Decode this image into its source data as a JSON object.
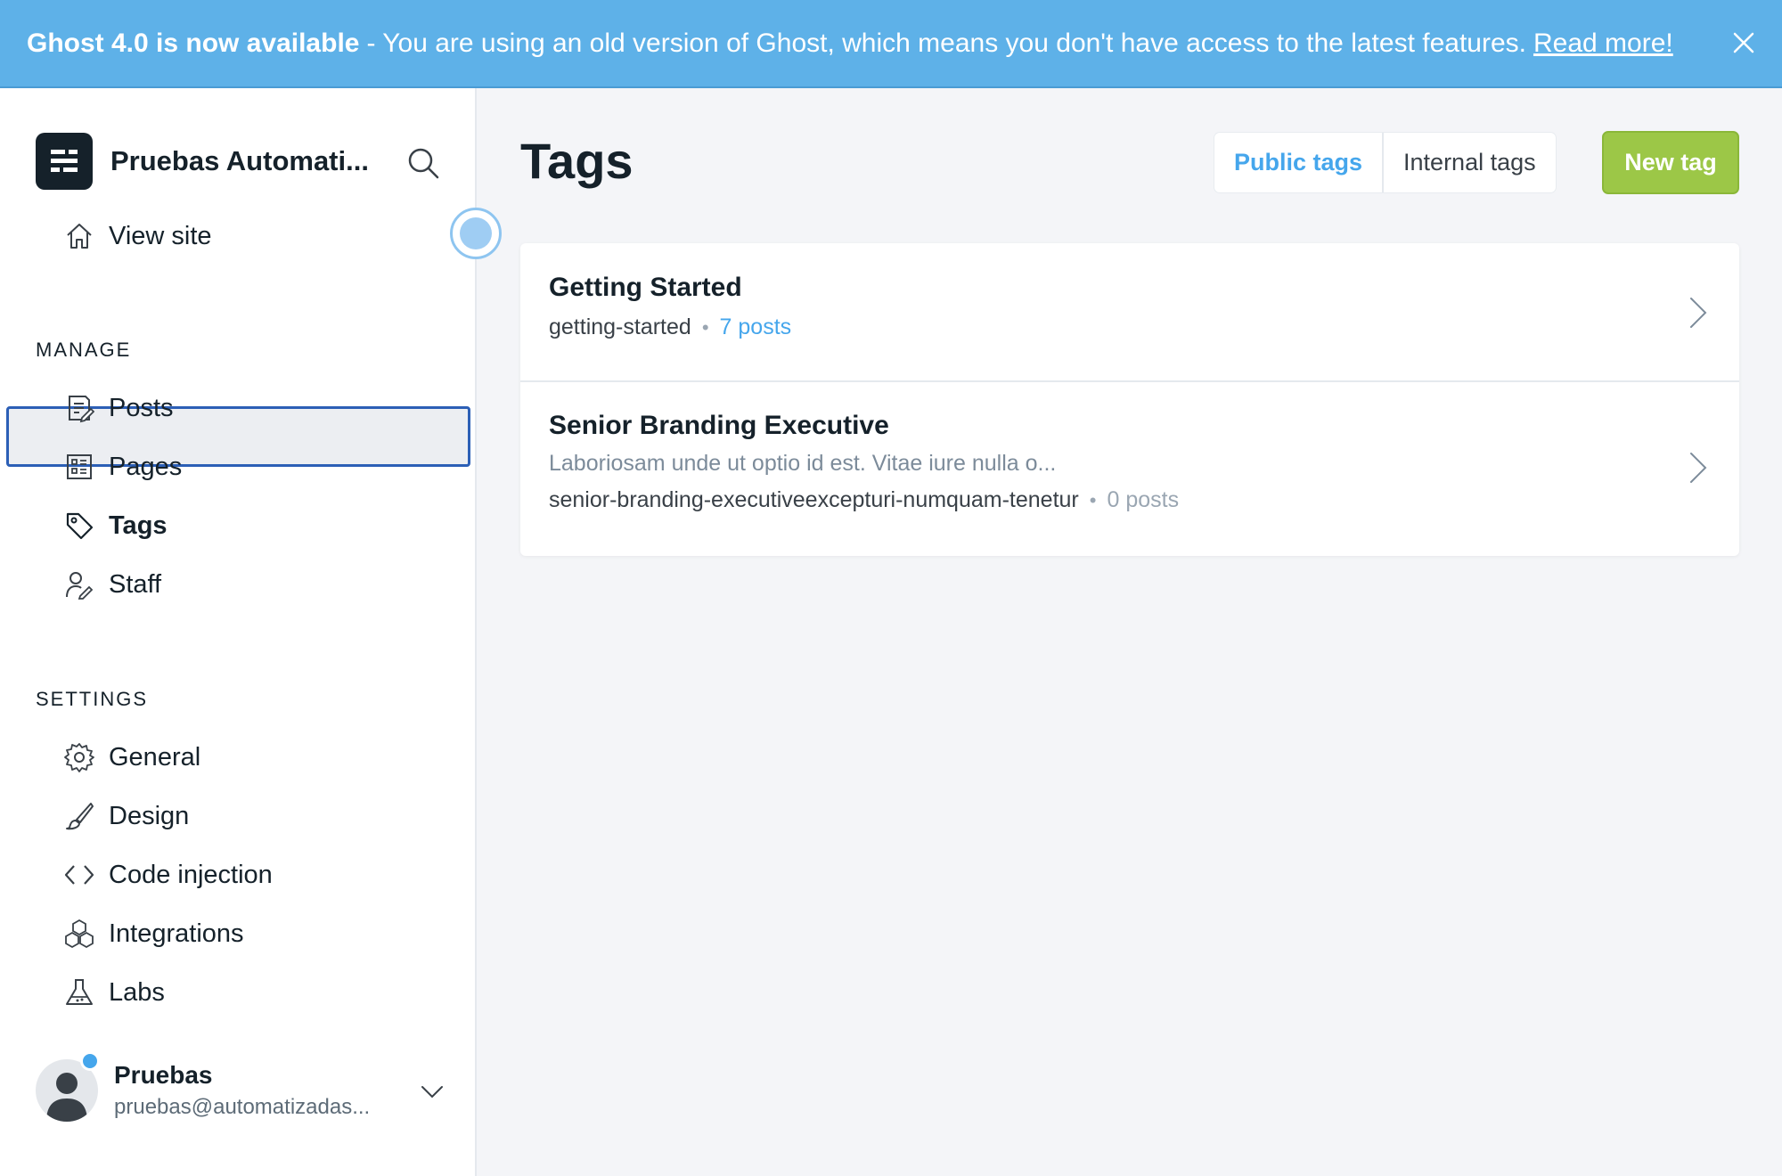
{
  "banner": {
    "title": "Ghost 4.0 is now available",
    "message": "- You are using an old version of Ghost, which means you don't have access to the latest features.",
    "link": "Read more!"
  },
  "sidebar": {
    "site_name": "Pruebas Automati...",
    "view_site": "View site",
    "manage_label": "MANAGE",
    "manage_items": [
      {
        "label": "Posts",
        "icon": "posts-icon"
      },
      {
        "label": "Pages",
        "icon": "pages-icon"
      },
      {
        "label": "Tags",
        "icon": "tag-icon"
      },
      {
        "label": "Staff",
        "icon": "staff-icon"
      }
    ],
    "settings_label": "SETTINGS",
    "settings_items": [
      {
        "label": "General",
        "icon": "gear-icon"
      },
      {
        "label": "Design",
        "icon": "brush-icon"
      },
      {
        "label": "Code injection",
        "icon": "code-icon"
      },
      {
        "label": "Integrations",
        "icon": "cubes-icon"
      },
      {
        "label": "Labs",
        "icon": "flask-icon"
      }
    ],
    "active_item": "Tags",
    "user": {
      "name": "Pruebas",
      "email": "pruebas@automatizadas..."
    }
  },
  "main": {
    "title": "Tags",
    "tabs": [
      {
        "label": "Public tags",
        "active": true
      },
      {
        "label": "Internal tags",
        "active": false
      }
    ],
    "new_tag_label": "New tag",
    "tags": [
      {
        "name": "Getting Started",
        "description": "",
        "slug": "getting-started",
        "count": "7 posts"
      },
      {
        "name": "Senior Branding Executive",
        "description": "Laboriosam unde ut optio id est. Vitae iure nulla o...",
        "slug": "senior-branding-executiveexcepturi-numquam-tenetur",
        "count": "0 posts"
      }
    ]
  },
  "colors": {
    "banner_bg": "#5eb1e8",
    "accent": "#45a6ec",
    "primary_button": "#9cc747",
    "active_nav_border": "#2c5fb6"
  }
}
